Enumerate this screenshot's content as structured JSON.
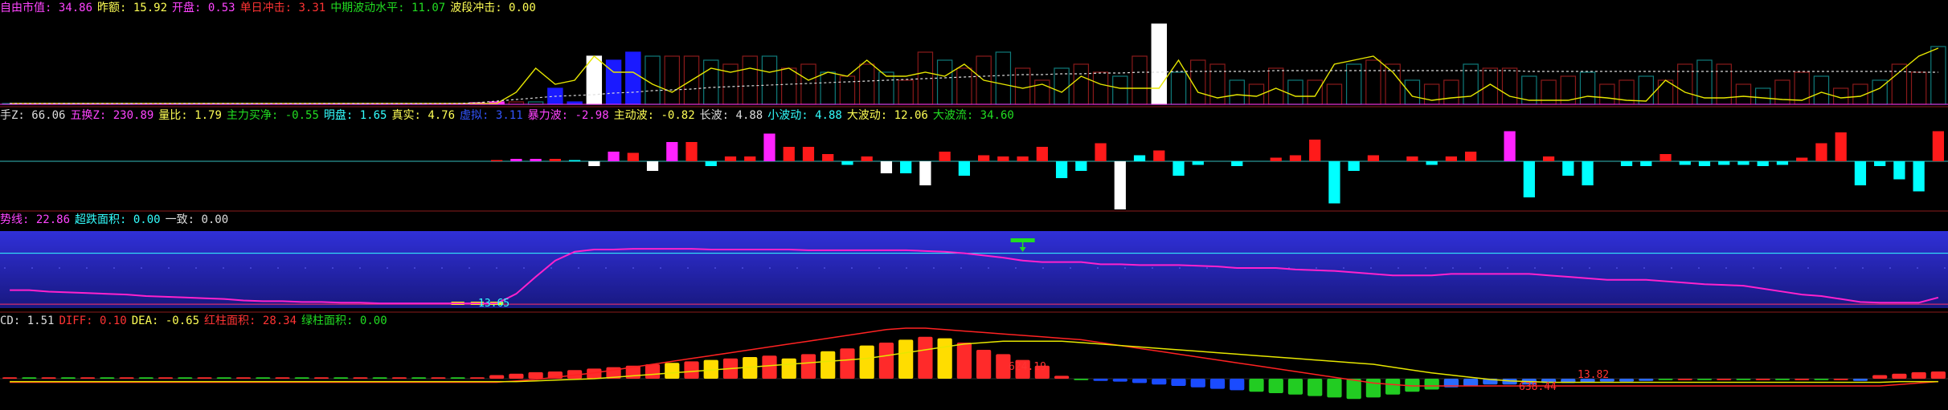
{
  "panel1": {
    "labels": [
      {
        "text": "自由市值: 34.86",
        "color": "#ff44ff"
      },
      {
        "text": "昨额: 15.92",
        "color": "#ffff55"
      },
      {
        "text": "开盘: 0.53",
        "color": "#ff44ff"
      },
      {
        "text": "单日冲击: 3.31",
        "color": "#ff3333"
      },
      {
        "text": "中期波动水平: 11.07",
        "color": "#22dd22"
      },
      {
        "text": "波段冲击: 0.00",
        "color": "#ffff55"
      }
    ]
  },
  "panel2": {
    "labels": [
      {
        "text": "手Z: 66.06",
        "color": "#dddddd"
      },
      {
        "text": "五换Z: 230.89",
        "color": "#ff44ff"
      },
      {
        "text": "量比: 1.79",
        "color": "#ffff55"
      },
      {
        "text": "主力买净: -0.55",
        "color": "#22dd22"
      },
      {
        "text": "明盘: 1.65",
        "color": "#33ffff"
      },
      {
        "text": "真实: 4.76",
        "color": "#ffff55"
      },
      {
        "text": "虚拟: 3.11",
        "color": "#3355ff"
      },
      {
        "text": "暴力波: -2.98",
        "color": "#ff44ff"
      },
      {
        "text": "主动波: -0.82",
        "color": "#ffff55"
      },
      {
        "text": "长波: 4.88",
        "color": "#dddddd"
      },
      {
        "text": "小波动: 4.88",
        "color": "#33ffff"
      },
      {
        "text": "大波动: 12.06",
        "color": "#ffff55"
      },
      {
        "text": "大波流: 34.60",
        "color": "#22dd22"
      }
    ]
  },
  "panel3": {
    "labels": [
      {
        "text": "势线: 22.86",
        "color": "#ff44ff"
      },
      {
        "text": "超跌面积: 0.00",
        "color": "#33ffff"
      },
      {
        "text": "一致: 0.00",
        "color": "#dddddd"
      }
    ],
    "value_label": "13.65"
  },
  "panel4": {
    "labels": [
      {
        "text": "CD: 1.51",
        "color": "#dddddd"
      },
      {
        "text": "DIFF: 0.10",
        "color": "#ff3333"
      },
      {
        "text": "DEA: -0.65",
        "color": "#ffff55"
      },
      {
        "text": "红柱面积: 28.34",
        "color": "#ff3333"
      },
      {
        "text": "绿柱面积: 0.00",
        "color": "#22dd22"
      }
    ],
    "value_labels": [
      "624.19",
      "638.44",
      "13.82"
    ]
  },
  "chart_data": {
    "type": "bar",
    "n": 100,
    "panel1": {
      "volume_bars": [
        1,
        1,
        1,
        1,
        1,
        1,
        1,
        1,
        1,
        1,
        1,
        1,
        1,
        1,
        1,
        1,
        1,
        1,
        1,
        1,
        1,
        1,
        1,
        1,
        2,
        3,
        3,
        3,
        20,
        3,
        60,
        55,
        65,
        60,
        60,
        60,
        55,
        50,
        60,
        60,
        45,
        50,
        40,
        35,
        50,
        40,
        30,
        65,
        55,
        45,
        60,
        65,
        45,
        30,
        45,
        50,
        40,
        35,
        60,
        100,
        40,
        55,
        50,
        30,
        25,
        45,
        30,
        30,
        25,
        50,
        55,
        50,
        30,
        25,
        30,
        50,
        45,
        45,
        35,
        30,
        35,
        40,
        25,
        30,
        35,
        30,
        50,
        55,
        50,
        25,
        20,
        30,
        40,
        35,
        20,
        25,
        30,
        50,
        40,
        72
      ],
      "line_yellow": [
        1,
        1,
        1,
        1,
        1,
        1,
        1,
        1,
        1,
        1,
        1,
        1,
        1,
        1,
        1,
        1,
        1,
        1,
        1,
        1,
        1,
        1,
        1,
        1,
        1,
        1,
        15,
        45,
        25,
        30,
        60,
        40,
        40,
        25,
        15,
        30,
        45,
        40,
        45,
        40,
        45,
        30,
        40,
        35,
        55,
        35,
        35,
        40,
        35,
        50,
        30,
        25,
        20,
        25,
        15,
        35,
        25,
        20,
        20,
        20,
        55,
        15,
        8,
        12,
        10,
        20,
        10,
        10,
        50,
        55,
        60,
        40,
        10,
        5,
        8,
        10,
        25,
        10,
        5,
        5,
        5,
        10,
        8,
        5,
        4,
        30,
        15,
        8,
        8,
        10,
        8,
        6,
        5,
        15,
        8,
        10,
        20,
        40,
        60,
        70
      ],
      "line_dotted": [
        1,
        1,
        1,
        1,
        1,
        1,
        1,
        1,
        1,
        1,
        1,
        1,
        1,
        1,
        1,
        1,
        1,
        1,
        1,
        1,
        1,
        1,
        1,
        1,
        2,
        4,
        6,
        8,
        10,
        11,
        12,
        14,
        15,
        17,
        18,
        19,
        21,
        22,
        23,
        24,
        25,
        26,
        27,
        28,
        29,
        30,
        31,
        32,
        33,
        34,
        35,
        36,
        37,
        37,
        38,
        38,
        39,
        39,
        40,
        40,
        41,
        41,
        41,
        41,
        41,
        42,
        42,
        42,
        42,
        42,
        42,
        42,
        42,
        42,
        42,
        42,
        42,
        42,
        41,
        41,
        41,
        41,
        41,
        41,
        41,
        41,
        41,
        41,
        41,
        41,
        41,
        41,
        41,
        41,
        41,
        41,
        41,
        41,
        40,
        40
      ]
    },
    "panel2": {
      "bars": [
        0,
        0,
        0,
        0,
        0,
        0,
        0,
        0,
        0,
        0,
        0,
        0,
        0,
        0,
        0,
        0,
        0,
        0,
        0,
        0,
        0,
        0,
        0,
        0,
        0,
        1,
        2,
        2,
        2,
        1,
        -4,
        8,
        7,
        -8,
        16,
        16,
        -4,
        4,
        4,
        23,
        12,
        12,
        6,
        -3,
        4,
        -10,
        -10,
        -20,
        8,
        -12,
        5,
        4,
        4,
        12,
        -14,
        -8,
        15,
        -40,
        5,
        9,
        -12,
        -3,
        0,
        -4,
        0,
        3,
        5,
        18,
        -35,
        -8,
        5,
        0,
        4,
        -3,
        4,
        8,
        0,
        25,
        -30,
        4,
        -12,
        -20,
        0,
        -4,
        -4,
        6,
        -3,
        -4,
        -3,
        -3,
        -4,
        -3,
        3,
        15,
        24,
        -20,
        -4,
        -15,
        -25,
        25
      ],
      "colors": [
        "c",
        "c",
        "c",
        "c",
        "c",
        "c",
        "c",
        "c",
        "c",
        "c",
        "c",
        "c",
        "c",
        "c",
        "c",
        "c",
        "c",
        "c",
        "c",
        "c",
        "c",
        "c",
        "c",
        "c",
        "c",
        "r",
        "m",
        "m",
        "r",
        "c",
        "w",
        "m",
        "r",
        "w",
        "m",
        "r",
        "c",
        "r",
        "r",
        "m",
        "r",
        "r",
        "r",
        "c",
        "r",
        "w",
        "c",
        "w",
        "r",
        "c",
        "r",
        "r",
        "r",
        "r",
        "c",
        "c",
        "r",
        "w",
        "c",
        "r",
        "c",
        "c",
        "c",
        "c",
        "c",
        "r",
        "r",
        "r",
        "c",
        "c",
        "r",
        "c",
        "r",
        "c",
        "r",
        "r",
        "c",
        "m",
        "c",
        "r",
        "c",
        "c",
        "c",
        "c",
        "c",
        "r",
        "c",
        "c",
        "c",
        "c",
        "c",
        "c",
        "r",
        "r",
        "r",
        "c",
        "c",
        "c",
        "c",
        "r"
      ]
    },
    "panel3": {
      "line": [
        20,
        20,
        18,
        17,
        16,
        15,
        14,
        12,
        11,
        10,
        9,
        8,
        6,
        5,
        5,
        4,
        4,
        3,
        3,
        2,
        2,
        2,
        2,
        2,
        2,
        2,
        15,
        38,
        60,
        72,
        75,
        75,
        76,
        76,
        76,
        76,
        75,
        75,
        75,
        75,
        75,
        74,
        74,
        74,
        74,
        74,
        74,
        73,
        72,
        70,
        67,
        64,
        60,
        58,
        58,
        58,
        55,
        55,
        54,
        54,
        54,
        53,
        52,
        50,
        50,
        50,
        48,
        47,
        46,
        44,
        42,
        40,
        40,
        40,
        42,
        42,
        42,
        42,
        42,
        40,
        38,
        36,
        34,
        34,
        34,
        32,
        30,
        28,
        27,
        26,
        22,
        18,
        14,
        12,
        8,
        4,
        3,
        3,
        3,
        10
      ],
      "h_line": 70,
      "base_line": 2,
      "yellow_blocks": [
        23,
        24,
        25
      ],
      "marker_index": 52
    },
    "panel4": {
      "macd_bars": [
        2,
        2,
        2,
        2,
        2,
        2,
        2,
        2,
        2,
        2,
        2,
        2,
        2,
        2,
        2,
        2,
        2,
        2,
        2,
        2,
        2,
        2,
        2,
        2,
        2,
        5,
        7,
        9,
        10,
        12,
        14,
        16,
        18,
        20,
        22,
        24,
        26,
        28,
        30,
        32,
        28,
        34,
        38,
        42,
        46,
        50,
        54,
        58,
        56,
        50,
        40,
        34,
        26,
        18,
        4,
        -2,
        -3,
        -4,
        -6,
        -8,
        -10,
        -12,
        -14,
        -16,
        -18,
        -20,
        -22,
        -24,
        -26,
        -28,
        -26,
        -22,
        -18,
        -15,
        -12,
        -10,
        -8,
        -8,
        -8,
        -6,
        -6,
        -5,
        -4,
        -4,
        -3,
        -2,
        -2,
        -2,
        -2,
        -2,
        -2,
        -2,
        -2,
        -2,
        -2,
        -3,
        5,
        7,
        9,
        10
      ],
      "diff_line": [
        -5,
        -5,
        -5,
        -5,
        -5,
        -5,
        -5,
        -5,
        -5,
        -5,
        -5,
        -5,
        -5,
        -5,
        -5,
        -5,
        -5,
        -5,
        -5,
        -5,
        -5,
        -5,
        -5,
        -5,
        -5,
        -5,
        -3,
        -1,
        2,
        5,
        8,
        12,
        16,
        20,
        24,
        28,
        32,
        36,
        40,
        44,
        48,
        52,
        56,
        60,
        64,
        68,
        70,
        70,
        68,
        66,
        64,
        62,
        60,
        58,
        56,
        54,
        50,
        46,
        42,
        38,
        34,
        30,
        26,
        22,
        18,
        14,
        10,
        6,
        2,
        -2,
        -6,
        -8,
        -10,
        -10,
        -10,
        -10,
        -10,
        -10,
        -10,
        -10,
        -10,
        -10,
        -10,
        -10,
        -10,
        -10,
        -10,
        -10,
        -10,
        -10,
        -10,
        -10,
        -10,
        -10,
        -10,
        -10,
        -10,
        -8,
        -6,
        -4
      ],
      "dea_line": [
        -4,
        -4,
        -4,
        -4,
        -4,
        -4,
        -4,
        -4,
        -4,
        -4,
        -4,
        -4,
        -4,
        -4,
        -4,
        -4,
        -4,
        -4,
        -4,
        -4,
        -4,
        -4,
        -4,
        -4,
        -4,
        -4,
        -4,
        -3,
        -2,
        -1,
        0,
        2,
        4,
        6,
        8,
        10,
        12,
        14,
        16,
        18,
        20,
        22,
        24,
        26,
        28,
        32,
        36,
        40,
        44,
        48,
        50,
        52,
        52,
        52,
        52,
        50,
        48,
        46,
        44,
        42,
        40,
        38,
        36,
        34,
        32,
        30,
        28,
        26,
        24,
        22,
        20,
        16,
        12,
        8,
        5,
        2,
        -1,
        -3,
        -4,
        -5,
        -5,
        -5,
        -5,
        -5,
        -5,
        -5,
        -5,
        -5,
        -5,
        -5,
        -5,
        -5,
        -5,
        -5,
        -5,
        -5,
        -5,
        -4,
        -4,
        -4
      ]
    }
  }
}
